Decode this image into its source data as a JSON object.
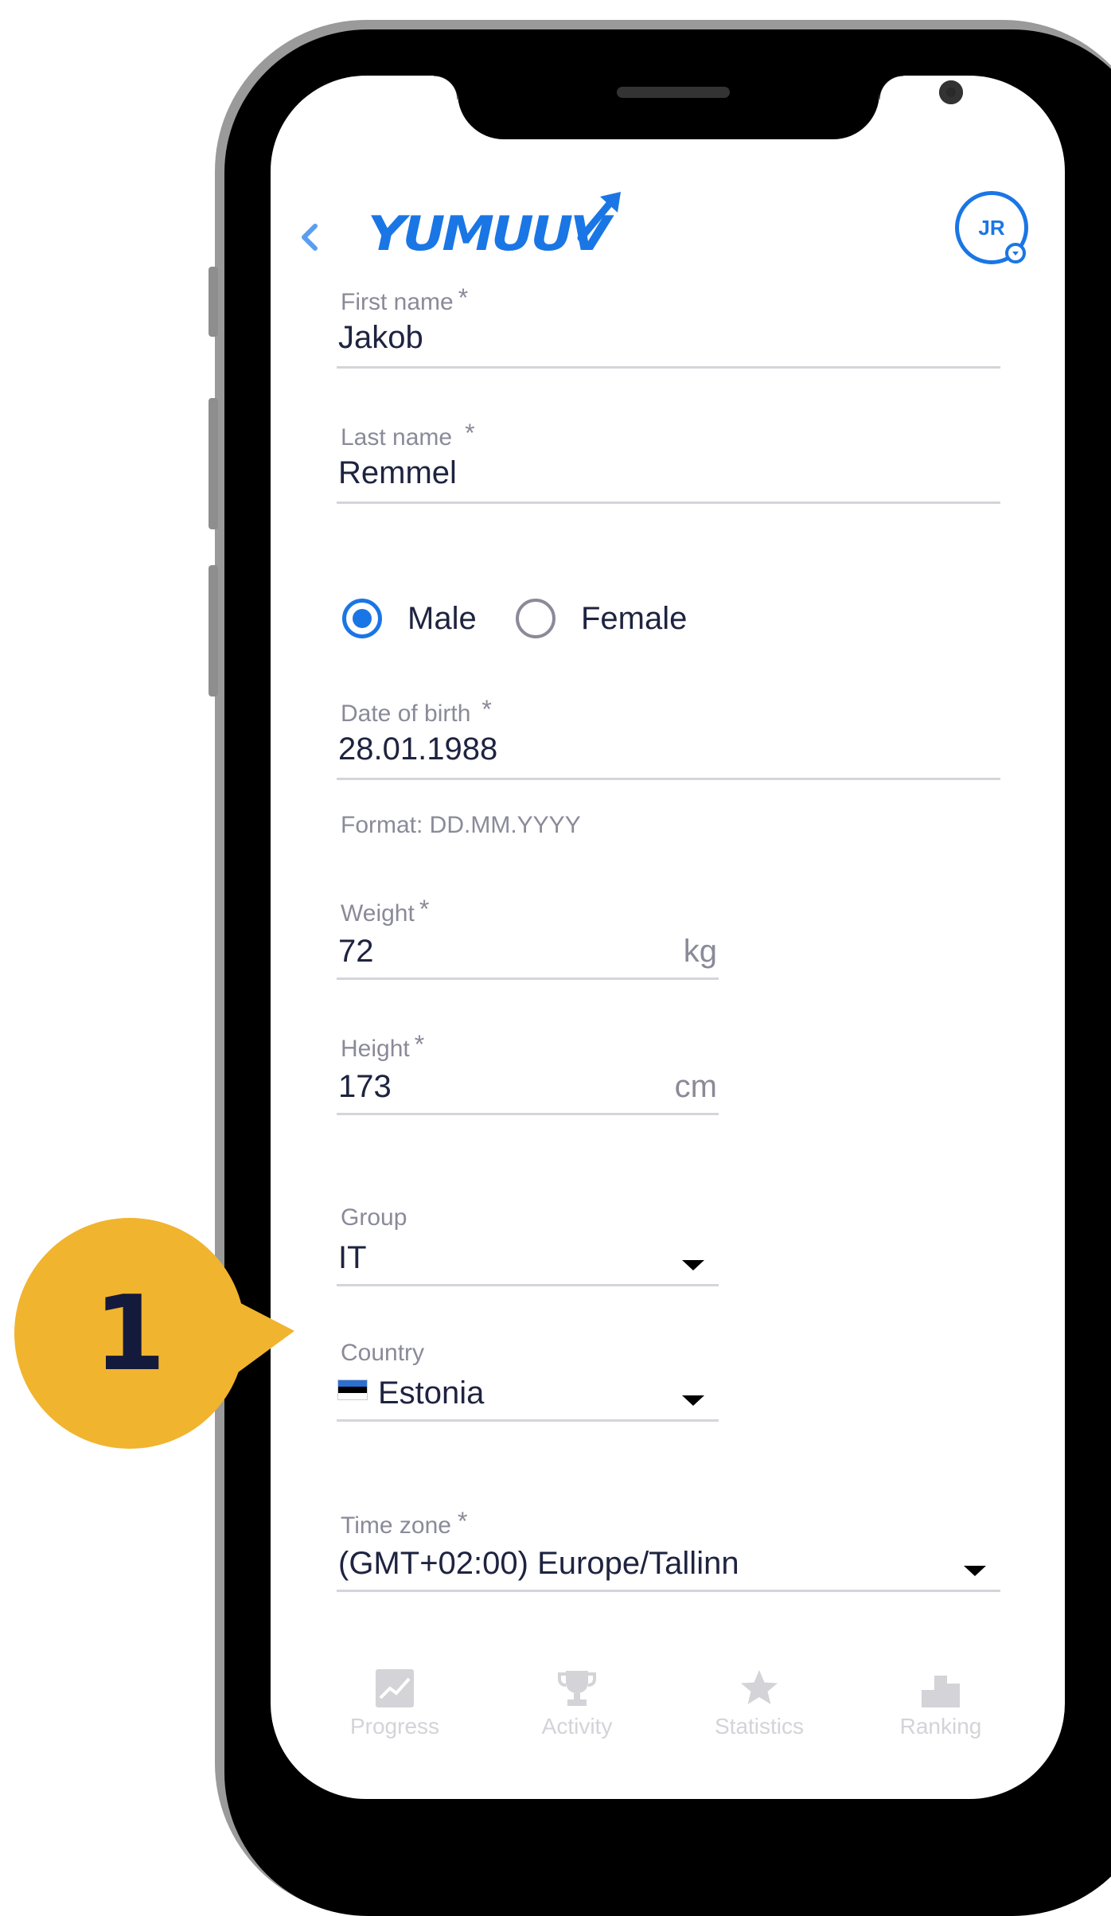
{
  "app": {
    "logo_text": "YUMUUV",
    "avatar_initials": "JR"
  },
  "form": {
    "first_name": {
      "label": "First name",
      "required": "*",
      "value": "Jakob"
    },
    "last_name": {
      "label": "Last name",
      "required": "*",
      "value": "Remmel"
    },
    "gender": {
      "options": [
        "Male",
        "Female"
      ],
      "selected": "Male"
    },
    "date_of_birth": {
      "label": "Date of birth",
      "required": "*",
      "value": "28.01.1988",
      "helper": "Format: DD.MM.YYYY"
    },
    "weight": {
      "label": "Weight",
      "required": "*",
      "value": "72",
      "unit": "kg"
    },
    "height": {
      "label": "Height",
      "required": "*",
      "value": "173",
      "unit": "cm"
    },
    "group": {
      "label": "Group",
      "value": "IT"
    },
    "country": {
      "label": "Country",
      "value": "Estonia"
    },
    "time_zone": {
      "label": "Time zone",
      "required": "*",
      "value": "(GMT+02:00) Europe/Tallinn"
    }
  },
  "bottom_nav": [
    {
      "label": "Progress",
      "icon": "chart-icon"
    },
    {
      "label": "Activity",
      "icon": "trophy-icon"
    },
    {
      "label": "Statistics",
      "icon": "star-icon"
    },
    {
      "label": "Ranking",
      "icon": "podium-icon"
    }
  ],
  "callout": {
    "number": "1"
  },
  "colors": {
    "brand": "#1a76e5",
    "callout": "#f0b42e",
    "text": "#1e2340",
    "muted": "#8a8a99"
  }
}
